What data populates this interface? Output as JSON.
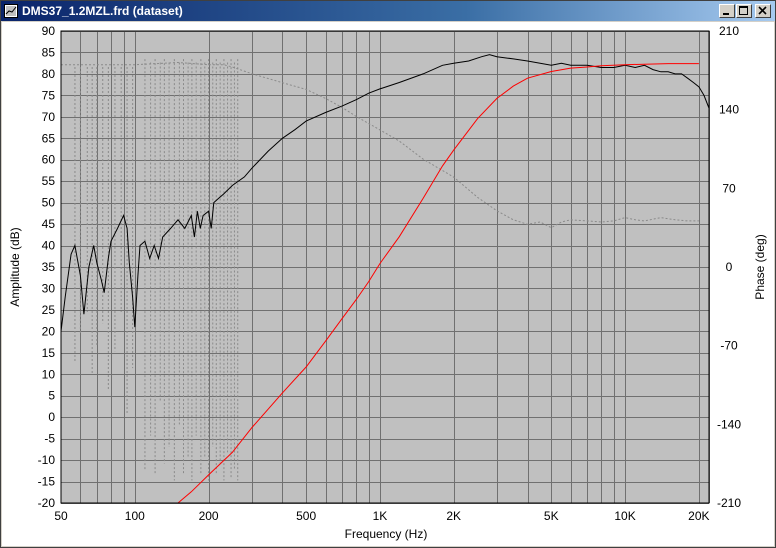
{
  "window": {
    "title": "DMS37_1.2MZL.frd (dataset)",
    "icons": {
      "app": "graph-doc-icon",
      "minimize": "minimize-icon",
      "maximize": "maximize-icon",
      "close": "close-icon"
    }
  },
  "colors": {
    "plot_bg": "#c0c0c0",
    "grid": "#707070",
    "amplitude": "#000000",
    "phase": "#8a8a8a",
    "reference": "#ff0000",
    "titlebar_start": "#0a246a",
    "titlebar_end": "#a6caf0"
  },
  "chart_data": {
    "type": "line",
    "title": "",
    "xlabel": "Frequency (Hz)",
    "ylabel": "Amplitude (dB)",
    "y2label": "Phase (deg)",
    "x_scale": "log",
    "xlim": [
      50,
      22000
    ],
    "ylim": [
      -20,
      90
    ],
    "y2lim": [
      -210,
      210
    ],
    "grid": true,
    "legend": "none",
    "x_ticks": [
      {
        "value": 50,
        "label": "50"
      },
      {
        "value": 100,
        "label": "100"
      },
      {
        "value": 200,
        "label": "200"
      },
      {
        "value": 500,
        "label": "500"
      },
      {
        "value": 1000,
        "label": "1K"
      },
      {
        "value": 2000,
        "label": "2K"
      },
      {
        "value": 5000,
        "label": "5K"
      },
      {
        "value": 10000,
        "label": "10K"
      },
      {
        "value": 20000,
        "label": "20K"
      }
    ],
    "y_ticks": [
      {
        "value": 90,
        "label": "90"
      },
      {
        "value": 85,
        "label": "85"
      },
      {
        "value": 80,
        "label": "80"
      },
      {
        "value": 75,
        "label": "75"
      },
      {
        "value": 70,
        "label": "70"
      },
      {
        "value": 65,
        "label": "65"
      },
      {
        "value": 60,
        "label": "60"
      },
      {
        "value": 55,
        "label": "55"
      },
      {
        "value": 50,
        "label": "50"
      },
      {
        "value": 45,
        "label": "45"
      },
      {
        "value": 40,
        "label": "40"
      },
      {
        "value": 35,
        "label": "35"
      },
      {
        "value": 30,
        "label": "30"
      },
      {
        "value": 25,
        "label": "25"
      },
      {
        "value": 20,
        "label": "20"
      },
      {
        "value": 15,
        "label": "15"
      },
      {
        "value": 10,
        "label": "10"
      },
      {
        "value": 5,
        "label": "5"
      },
      {
        "value": 0,
        "label": "0"
      },
      {
        "value": -5,
        "label": "-5"
      },
      {
        "value": -10,
        "label": "-10"
      },
      {
        "value": -15,
        "label": "-15"
      },
      {
        "value": -20,
        "label": "-20"
      }
    ],
    "y2_ticks": [
      {
        "value": 210,
        "label": "210"
      },
      {
        "value": 140,
        "label": "140"
      },
      {
        "value": 70,
        "label": "70"
      },
      {
        "value": 0,
        "label": "0"
      },
      {
        "value": -70,
        "label": "-70"
      },
      {
        "value": -140,
        "label": "-140"
      },
      {
        "value": -210,
        "label": "-210"
      }
    ],
    "series": [
      {
        "axis": "left",
        "style": "solid",
        "color": "#000000",
        "x": [
          50,
          52,
          55,
          57,
          60,
          62,
          65,
          68,
          70,
          73,
          75,
          78,
          80,
          85,
          90,
          93,
          95,
          98,
          100,
          103,
          105,
          110,
          115,
          120,
          125,
          130,
          140,
          150,
          160,
          170,
          175,
          180,
          185,
          190,
          200,
          205,
          210,
          220,
          230,
          250,
          280,
          300,
          350,
          400,
          450,
          500,
          600,
          700,
          800,
          900,
          1000,
          1200,
          1500,
          1800,
          2000,
          2300,
          2600,
          2800,
          3000,
          3500,
          4000,
          5000,
          5500,
          6000,
          7000,
          8000,
          9000,
          10000,
          11000,
          12000,
          13000,
          14000,
          15000,
          16000,
          17000,
          18000,
          19000,
          20000,
          21000,
          22000
        ],
        "y": [
          20,
          28,
          38,
          40,
          33,
          24,
          35,
          40,
          36,
          32,
          29,
          37,
          41,
          44,
          47,
          44,
          36,
          28,
          21,
          33,
          40,
          41,
          37,
          40,
          37,
          42,
          44,
          46,
          44,
          47,
          42,
          48,
          44,
          47,
          48,
          44,
          50,
          51,
          52,
          54,
          56,
          58,
          62,
          65,
          67,
          69,
          71,
          72.5,
          74,
          75.5,
          76.5,
          78,
          80,
          82,
          82.5,
          83,
          84,
          84.5,
          84,
          83.5,
          83,
          82,
          82.5,
          82,
          82,
          81.5,
          81.5,
          82,
          81.5,
          82,
          81,
          80.5,
          80.5,
          80,
          80,
          79,
          78,
          77,
          75,
          72
        ]
      },
      {
        "axis": "right",
        "style": "dashed",
        "color": "#8a8a8a",
        "x": [
          50,
          100,
          150,
          200,
          230,
          250,
          300,
          400,
          500,
          600,
          700,
          800,
          1000,
          1200,
          1500,
          2000,
          2500,
          3000,
          3500,
          4000,
          4500,
          5000,
          5500,
          6000,
          7000,
          8000,
          9000,
          10000,
          11000,
          12000,
          14000,
          16000,
          18000,
          20000
        ],
        "y": [
          180,
          180,
          182,
          180,
          180,
          178,
          172,
          164,
          158,
          150,
          142,
          134,
          122,
          112,
          96,
          80,
          62,
          50,
          42,
          38,
          40,
          35,
          40,
          42,
          41,
          40,
          41,
          44,
          42,
          41,
          44,
          42,
          41,
          41
        ]
      },
      {
        "axis": "right",
        "style": "solid",
        "color": "#ff0000",
        "x": [
          150,
          170,
          200,
          250,
          300,
          400,
          500,
          600,
          700,
          800,
          900,
          1000,
          1200,
          1500,
          1800,
          2000,
          2500,
          3000,
          3500,
          4000,
          5000,
          6000,
          7000,
          8000,
          10000,
          12000,
          15000,
          18000,
          20000
        ],
        "y": [
          -210,
          -200,
          -185,
          -165,
          -143,
          -112,
          -89,
          -66,
          -46,
          -29,
          -13,
          3,
          27,
          61,
          90,
          104,
          132,
          150,
          161,
          168,
          174,
          177,
          178,
          179,
          180,
          180.5,
          181,
          181,
          181
        ]
      }
    ],
    "grid_spikes": {
      "x": [
        57,
        60,
        64,
        67,
        70,
        74,
        78,
        83,
        88,
        93,
        98,
        110,
        116,
        121,
        127,
        132,
        138,
        145,
        152,
        158,
        165,
        171,
        178,
        186,
        193,
        200,
        208,
        215,
        223,
        231,
        239,
        247,
        255,
        263
      ],
      "top": [
        178,
        178,
        178,
        178,
        178,
        178,
        178,
        178,
        178,
        178,
        178,
        185,
        182,
        185,
        182,
        185,
        182,
        185,
        182,
        185,
        182,
        185,
        182,
        185,
        182,
        185,
        182,
        185,
        182,
        185,
        182,
        185,
        182,
        185
      ],
      "bottom": [
        -85,
        -60,
        -40,
        -95,
        -70,
        -50,
        -110,
        -75,
        -40,
        -130,
        -90,
        -180,
        -150,
        -185,
        -120,
        -175,
        -160,
        -190,
        -140,
        -185,
        -170,
        -190,
        -150,
        -185,
        -170,
        -190,
        -160,
        -185,
        -175,
        -190,
        -165,
        -188,
        -180,
        -190
      ]
    }
  }
}
